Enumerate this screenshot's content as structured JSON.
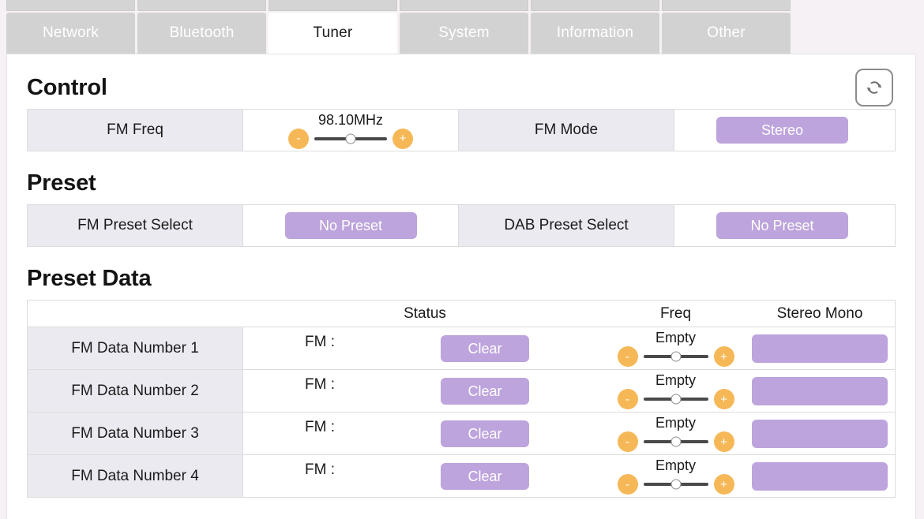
{
  "tabs": {
    "items": [
      {
        "label": "Network",
        "active": false
      },
      {
        "label": "Bluetooth",
        "active": false
      },
      {
        "label": "Tuner",
        "active": true
      },
      {
        "label": "System",
        "active": false
      },
      {
        "label": "Information",
        "active": false
      },
      {
        "label": "Other",
        "active": false
      }
    ]
  },
  "colors": {
    "accent_purple": "#bda4dc",
    "accent_orange": "#f6b857",
    "tab_inactive": "#d2d2d2",
    "label_cell": "#eceaf1",
    "page_background": "#f6f1f4"
  },
  "refresh": {
    "icon": "refresh-icon"
  },
  "control": {
    "title": "Control",
    "fm_freq_label": "FM Freq",
    "fm_freq_value": "98.10MHz",
    "minus_label": "-",
    "plus_label": "+",
    "fm_mode_label": "FM Mode",
    "fm_mode_value": "Stereo"
  },
  "preset": {
    "title": "Preset",
    "fm_preset_label": "FM Preset Select",
    "fm_preset_value": "No Preset",
    "dab_preset_label": "DAB Preset Select",
    "dab_preset_value": "No Preset"
  },
  "preset_data": {
    "title": "Preset Data",
    "headers": {
      "name": "",
      "status": "Status",
      "freq": "Freq",
      "stereo_mono": "Stereo Mono"
    },
    "clear_label": "Clear",
    "minus_label": "-",
    "plus_label": "+",
    "rows": [
      {
        "name": "FM Data Number 1",
        "status": "FM :",
        "clear": "Clear",
        "freq": "Empty",
        "stereo_mono": ""
      },
      {
        "name": "FM Data Number 2",
        "status": "FM :",
        "clear": "Clear",
        "freq": "Empty",
        "stereo_mono": ""
      },
      {
        "name": "FM Data Number 3",
        "status": "FM :",
        "clear": "Clear",
        "freq": "Empty",
        "stereo_mono": ""
      },
      {
        "name": "FM Data Number 4",
        "status": "FM :",
        "clear": "Clear",
        "freq": "Empty",
        "stereo_mono": ""
      }
    ]
  }
}
